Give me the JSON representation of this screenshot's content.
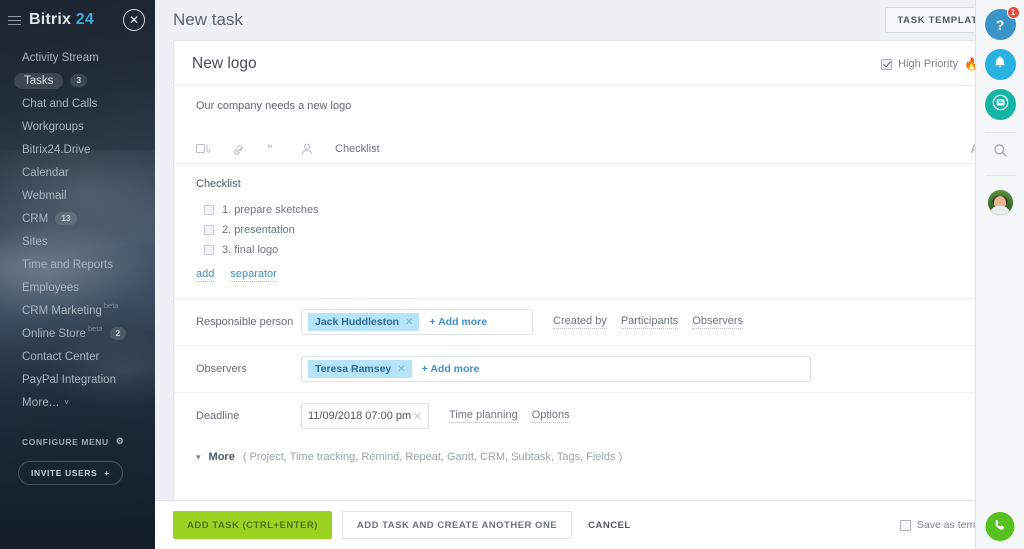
{
  "sidebar": {
    "logo_text": "Bitrix",
    "logo_number": "24",
    "burger_icon": "hamburger-icon",
    "close_icon": "close-icon",
    "items": [
      {
        "label": "Activity Stream",
        "badge": "",
        "beta": "",
        "active": false
      },
      {
        "label": "Tasks",
        "badge": "3",
        "beta": "",
        "active": true
      },
      {
        "label": "Chat and Calls",
        "badge": "",
        "beta": "",
        "active": false
      },
      {
        "label": "Workgroups",
        "badge": "",
        "beta": "",
        "active": false
      },
      {
        "label": "Bitrix24.Drive",
        "badge": "",
        "beta": "",
        "active": false
      },
      {
        "label": "Calendar",
        "badge": "",
        "beta": "",
        "active": false
      },
      {
        "label": "Webmail",
        "badge": "",
        "beta": "",
        "active": false
      },
      {
        "label": "CRM",
        "badge": "13",
        "beta": "",
        "active": false
      },
      {
        "label": "Sites",
        "badge": "",
        "beta": "",
        "active": false
      },
      {
        "label": "Time and Reports",
        "badge": "",
        "beta": "",
        "active": false
      },
      {
        "label": "Employees",
        "badge": "",
        "beta": "",
        "active": false
      },
      {
        "label": "CRM Marketing",
        "badge": "",
        "beta": "beta",
        "active": false
      },
      {
        "label": "Online Store",
        "badge": "2",
        "beta": "beta",
        "active": false
      },
      {
        "label": "Contact Center",
        "badge": "",
        "beta": "",
        "active": false
      },
      {
        "label": "PayPal Integration",
        "badge": "",
        "beta": "",
        "active": false
      },
      {
        "label": "More...",
        "badge": "",
        "beta": "",
        "active": false
      }
    ],
    "configure_menu": "CONFIGURE MENU",
    "configure_icon": "gear-icon",
    "invite_users": "INVITE USERS",
    "invite_icon": "plus-icon"
  },
  "header": {
    "page_title": "New task",
    "task_templates_label": "TASK TEMPLATES",
    "task_templates_icon": "chevron-down-icon"
  },
  "task": {
    "title": "New logo",
    "priority_label": "High Priority",
    "priority_checked": true,
    "priority_icon": "flame-icon",
    "description": "Our company needs a new logo",
    "toolbar": {
      "icons": [
        "attach-file-icon",
        "link-icon",
        "quote-icon",
        "mention-person-icon"
      ],
      "checklist_label": "Checklist",
      "font_icon": "font-color-icon",
      "font_glyph": "A"
    },
    "checklist": {
      "heading": "Checklist",
      "items": [
        {
          "text": "1. prepare sketches",
          "checked": false
        },
        {
          "text": "2. presentation",
          "checked": false
        },
        {
          "text": "3. final logo",
          "checked": false
        }
      ],
      "add_label": "add",
      "separator_label": "separator"
    },
    "fields": {
      "responsible": {
        "label": "Responsible person",
        "person": "Jack Huddleston",
        "remove_icon": "remove-icon",
        "add_more": "+ Add more",
        "links": [
          "Created by",
          "Participants",
          "Observers"
        ]
      },
      "observers": {
        "label": "Observers",
        "person": "Teresa Ramsey",
        "remove_icon": "remove-icon",
        "add_more": "+ Add more"
      },
      "deadline": {
        "label": "Deadline",
        "value": "11/09/2018 07:00 pm",
        "clear_icon": "clear-icon",
        "links": [
          "Time planning",
          "Options"
        ]
      }
    },
    "more_row": {
      "caret_icon": "chevron-down-icon",
      "word": "More",
      "list": "( Project,  Time tracking,  Remind,  Repeat,  Gantt,  CRM,  Subtask,  Tags,  Fields )"
    }
  },
  "footer": {
    "add_task": "ADD TASK (CTRL+ENTER)",
    "add_another": "ADD TASK AND CREATE ANOTHER ONE",
    "cancel": "CANCEL",
    "save_as_template": "Save as template",
    "save_checked": false
  },
  "rail": {
    "help": {
      "icon": "help-icon",
      "glyph": "?",
      "badge": "1",
      "color": "#3a94c8"
    },
    "notifications": {
      "icon": "bell-icon",
      "glyph": "▲",
      "color": "#29b1e0"
    },
    "messenger": {
      "icon": "chat-icon",
      "color": "#14b5a5"
    },
    "search": {
      "icon": "search-icon"
    },
    "avatar": {
      "icon": "avatar"
    },
    "phone": {
      "icon": "phone-icon",
      "color": "#57c11f"
    }
  },
  "scrollbar": {
    "up_icon": "scroll-up-arrow-icon",
    "down_icon": "scroll-down-arrow-icon"
  }
}
